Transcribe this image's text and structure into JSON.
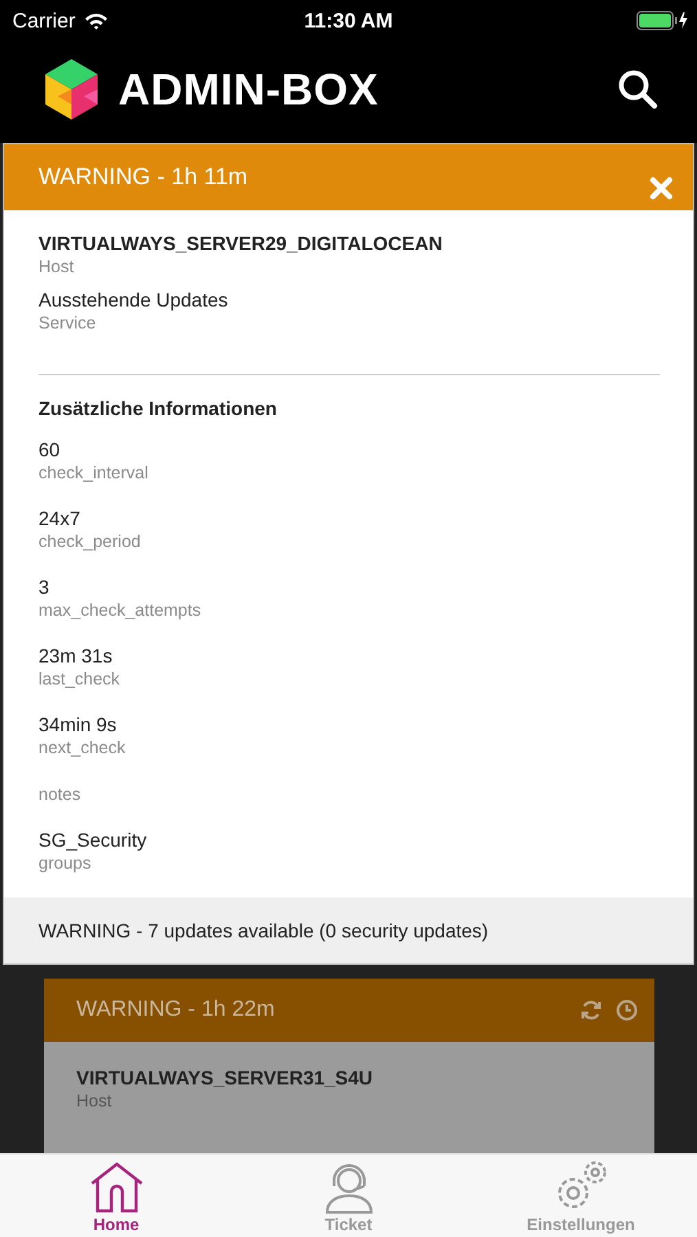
{
  "status_bar": {
    "carrier": "Carrier",
    "time": "11:30 AM"
  },
  "app_bar": {
    "title": "ADMIN-BOX"
  },
  "modal": {
    "title": "WARNING - 1h 11m",
    "host": "VIRTUALWAYS_SERVER29_DIGITALOCEAN",
    "host_label": "Host",
    "service": "Ausstehende Updates",
    "service_label": "Service",
    "section_title": "Zusätzliche Informationen",
    "details": [
      {
        "value": "60",
        "label": "check_interval"
      },
      {
        "value": "24x7",
        "label": "check_period"
      },
      {
        "value": "3",
        "label": "max_check_attempts"
      },
      {
        "value": "23m 31s",
        "label": "last_check"
      },
      {
        "value": "34min 9s",
        "label": "next_check"
      },
      {
        "label": "notes"
      },
      {
        "value": "SG_Security",
        "label": "groups"
      }
    ],
    "footer": "WARNING - 7 updates available (0 security updates)"
  },
  "background_card": {
    "title": "WARNING - 1h 22m",
    "host": "VIRTUALWAYS_SERVER31_S4U",
    "host_label": "Host"
  },
  "tabs": [
    {
      "label": "Home",
      "kind": "house",
      "selected": true
    },
    {
      "label": "Ticket",
      "kind": "headset",
      "selected": false
    },
    {
      "label": "Einstellungen",
      "kind": "gears",
      "selected": false
    }
  ]
}
